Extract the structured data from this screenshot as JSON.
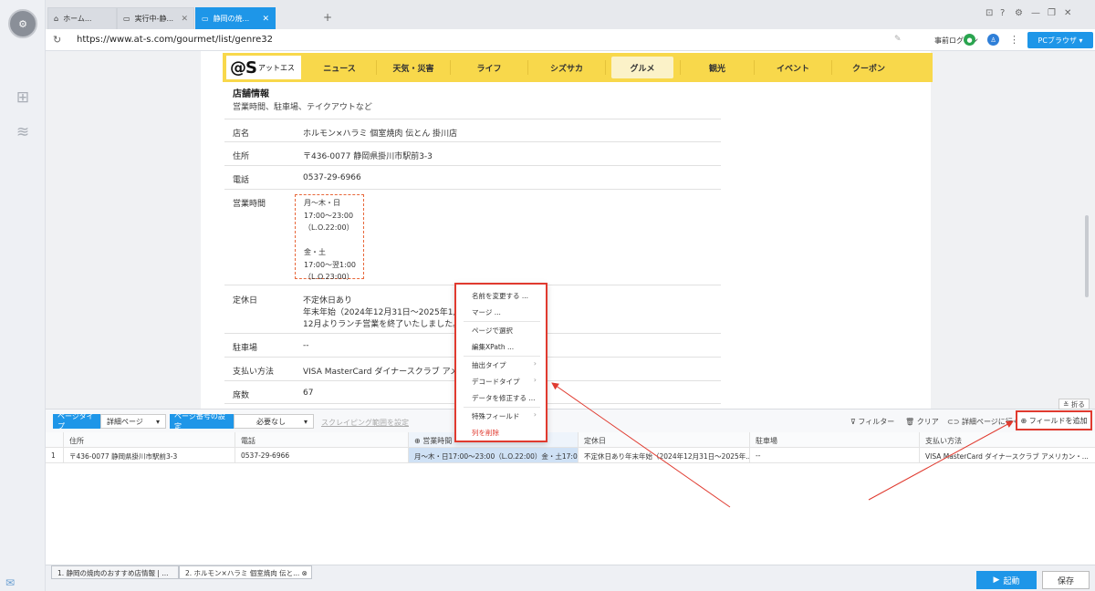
{
  "browser": {
    "tabs": [
      {
        "label": "ホーム...",
        "icon": "home-icon"
      },
      {
        "label": "実行中-静...",
        "icon": "page-icon"
      },
      {
        "label": "静岡の焼...",
        "icon": "page-icon"
      }
    ],
    "url": "https://www.at-s.com/gourmet/list/genre32",
    "prelogin": "事前ログイン",
    "pc_browser": "PCブラウザ"
  },
  "site": {
    "logo_big": "@S",
    "logo_small": "アットエス",
    "nav": [
      "ニュース",
      "天気・災害",
      "ライフ",
      "シズサカ",
      "グルメ",
      "観光",
      "イベント",
      "クーポン"
    ],
    "current_nav": "グルメ"
  },
  "shop": {
    "title": "店舗情報",
    "subtitle": "営業時間、駐車場、テイクアウトなど",
    "rows": [
      {
        "label": "店名",
        "value": "ホルモン×ハラミ 個室焼肉 伝とん 掛川店"
      },
      {
        "label": "住所",
        "value": "〒436-0077 静岡県掛川市駅前3-3"
      },
      {
        "label": "電話",
        "value": "0537-29-6966"
      },
      {
        "label": "営業時間",
        "value": ""
      },
      {
        "label": "定休日",
        "value": "不定休日あり",
        "value2": "年末年始（2024年12月31日〜2025年1月3",
        "value3": "12月よりランチ営業を終了いたしました。"
      },
      {
        "label": "駐車場",
        "value": "--"
      },
      {
        "label": "支払い方法",
        "value": "VISA MasterCard ダイナースクラブ アメリ"
      },
      {
        "label": "席数",
        "value": "67"
      }
    ],
    "hours_lines": [
      "月〜木・日",
      "17:00〜23:00",
      "（L.O.22:00）",
      "",
      "金・土",
      "17:00〜翌1:00",
      "（L.O.23:00）"
    ]
  },
  "context_menu": {
    "items": [
      "名前を変更する ...",
      "マージ ...",
      "ページで選択",
      "編集XPath ...",
      "抽出タイプ",
      "デコードタイプ",
      "データを修正する ...",
      "特殊フィールド",
      "列を削除"
    ],
    "delete_color": "#e03a2f"
  },
  "toolbar": {
    "page_type_label": "ページタイプ",
    "page_type_value": "詳細ページ",
    "page_number_label": "ページ番号の設定",
    "page_number_value": "必要なし",
    "scrape_range": "スクレイピング範囲を設定",
    "filter": "フィルター",
    "clear": "クリア",
    "detail_page": "詳細ページに行く",
    "add_field": "フィールドを追加",
    "fold": "折る"
  },
  "table": {
    "headers": [
      "住所",
      "電話",
      "営業時間",
      "定休日",
      "駐車場",
      "支払い方法"
    ],
    "rows": [
      {
        "index": "1",
        "cells": [
          "〒436-0077 静岡県掛川市駅前3-3",
          "0537-29-6966",
          "月〜木・日17:00〜23:00（L.O.22:00）金・土17:00...",
          "不定休日あり年末年始（2024年12月31日〜2025年...",
          "--",
          "VISA MasterCard ダイナースクラブ アメリカン・..."
        ]
      }
    ]
  },
  "bottom": {
    "tabs": [
      "1. 静岡の焼肉のおすすめ店情報 | ...",
      "2. ホルモン×ハラミ 個室焼肉 伝と..."
    ],
    "run": "起動",
    "save": "保存"
  },
  "colors": {
    "accent": "#1e96e8",
    "site_yellow": "#f8d84b",
    "highlight_red": "#e03a2f"
  }
}
